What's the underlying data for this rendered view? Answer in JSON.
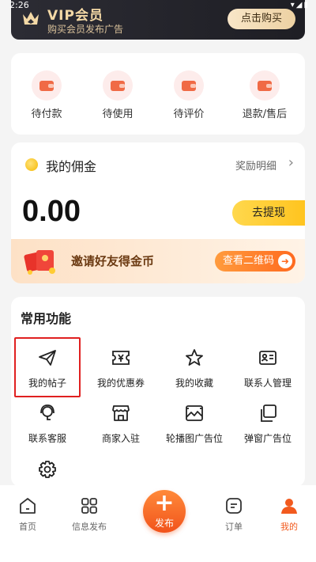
{
  "status_bar": {
    "time": "2:26",
    "right": "▾◢▮"
  },
  "vip": {
    "title": "VIP会员",
    "subtitle": "购买会员发布广告",
    "buy_label": "点击购买"
  },
  "orders": [
    {
      "label": "待付款",
      "icon": "wallet-icon"
    },
    {
      "label": "待使用",
      "icon": "wallet-icon"
    },
    {
      "label": "待评价",
      "icon": "wallet-icon"
    },
    {
      "label": "退款/售后",
      "icon": "wallet-icon"
    }
  ],
  "commission": {
    "title": "我的佣金",
    "detail_label": "奖励明细",
    "amount": "0.00",
    "withdraw_label": "去提现",
    "invite_text": "邀请好友得金币",
    "qr_label": "查看二维码"
  },
  "functions": {
    "title": "常用功能",
    "items": [
      {
        "label": "我的帖子",
        "icon": "paper-plane-icon"
      },
      {
        "label": "我的优惠券",
        "icon": "coupon-icon"
      },
      {
        "label": "我的收藏",
        "icon": "star-icon"
      },
      {
        "label": "联系人管理",
        "icon": "contact-card-icon"
      },
      {
        "label": "联系客服",
        "icon": "headset-icon"
      },
      {
        "label": "商家入驻",
        "icon": "store-icon"
      },
      {
        "label": "轮播图广告位",
        "icon": "image-icon"
      },
      {
        "label": "弹窗广告位",
        "icon": "copy-icon"
      },
      {
        "label": "",
        "icon": "gear-icon"
      }
    ]
  },
  "nav": {
    "items": [
      {
        "label": "首页",
        "icon": "home-icon"
      },
      {
        "label": "信息发布",
        "icon": "grid-icon"
      },
      {
        "label": "发布",
        "icon": "plus-icon"
      },
      {
        "label": "订单",
        "icon": "order-icon"
      },
      {
        "label": "我的",
        "icon": "user-icon"
      }
    ],
    "active": "我的",
    "accent": "#f25a1e"
  }
}
